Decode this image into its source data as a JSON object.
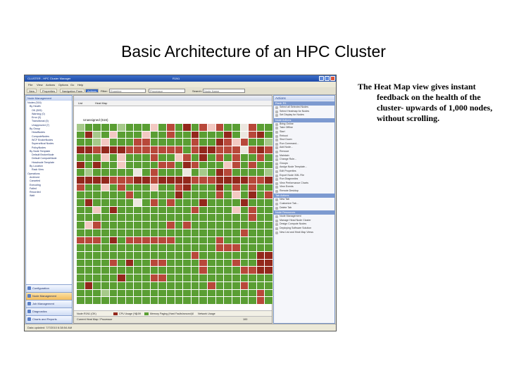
{
  "slide": {
    "title": "Basic Architecture of an HPC Cluster",
    "caption": "The Heat Map view gives instant feedback on the health of the cluster- upwards of 1,000 nodes, without scrolling."
  },
  "window": {
    "title": "CLUSTER - HPC Cluster Manager",
    "node_title": "R1N1"
  },
  "menu": [
    "File",
    "View",
    "Actions",
    "Options",
    "Go",
    "Help"
  ],
  "toolbar": {
    "buttons": [
      "New",
      "Properties",
      "Navigation Pane",
      "Actions"
    ],
    "filter_label": "Filter:",
    "filter_value": "Examine",
    "filter_value2": "Processor",
    "search_label": "Search:",
    "search_placeholder": "Node Name"
  },
  "left_pane": {
    "header": "Node Management",
    "tree": [
      "Nodes (516)",
      "By Health",
      "OK (509)",
      "Warning (0)",
      "Error (0)",
      "Transitional (0)",
      "Unapproved (7)",
      "By Group",
      "HeadNodes",
      "ComputeNodes",
      "WCF BrokerNodes",
      "Supercritical Nodes",
      "PolicyNodes",
      "By Node Template",
      "Default BrokerNode",
      "Default ComputeNode",
      "Headnode Template",
      "By Location",
      "Rack View",
      "Operations",
      "Archived",
      "Canceled",
      "Executing",
      "Failed",
      "Recorded",
      "Wait"
    ],
    "nav": [
      "Configuration",
      "Node Management",
      "Job Management",
      "Diagnostics",
      "Charts and Reports"
    ]
  },
  "center": {
    "tabs": [
      "List",
      "Heat Map"
    ],
    "group_label": "Unassigned (516)",
    "status": {
      "node_label": "Node:",
      "node_value": "R1N1 (OK)",
      "cpu_label": "CPU Usage (%):",
      "cpu_value": "2.59",
      "mem_label": "Memory Paging (Hard Faults/second):",
      "mem_value": "0",
      "network_label": "Network Usage",
      "current_view": "Current Heat Map / Processor",
      "zoom": "100"
    }
  },
  "heatmap": {
    "colors": {
      "g": "#5a9e33",
      "l": "#a6c98a",
      "p": "#f3c9c2",
      "w": "#ece7e0",
      "r": "#b8483a",
      "d": "#93281c"
    },
    "rows": [
      "lgggglgggpgrgdgrprggwrgg",
      "gdlgpgggpggrggdgggdgwrdg",
      "gglpgggrrgggggrggdrprggl",
      "ddrdddrrrrrrrgrddrrrwrdr",
      "gggpgpgggrggprgdgrgrggrg",
      "dgdggpggggrrgdrgggprgrgg",
      "glgggggwgrgggwglgdrggggl",
      "ddddrrrddrddddrrrddddrrd",
      "rggpgrgggpggrdgggdgrgrgg",
      "ggggggrgggggdggggrgpgdgr",
      "gdgggggwgrgrgggdggggdggg",
      "ggpgdgggggggggrggggpgrgg",
      "gggggggggggggggggggggrgg",
      "gprggggggggrgrgggggggggg",
      "ggggggggggggggggggggrggg",
      "rrrgdgrrrrrrgggggrgggggg",
      "gggggggggggggggggrrrgggg",
      "ggggggggggggggrgggggggdd",
      "ggggrgdggrrggggrgggrggdd",
      "gggggggggggggggrggggrrdd",
      "gggggdgggrrggggggggggggg",
      "gdggggggggggggggrgggrggg",
      "ggglggggggggggggggggggrg",
      "ggggggggggggggggggggggrg"
    ]
  },
  "actions": {
    "header": "Actions",
    "sections": [
      {
        "title": "Rack: R1",
        "items": [
          "Select all Selected Nodes",
          "Select Heatmap for Nodes",
          "Set Display for Nodes"
        ]
      },
      {
        "title": "Node Actions",
        "items": [
          "Bring Online",
          "Take Offline",
          "Start",
          "Reboot",
          "Shut Down",
          "Run Command...",
          "Add Node...",
          "Remove",
          "Maintain",
          "Change Role...",
          "Groups",
          "Assign Node Template...",
          "Edit Properties",
          "Export Node XML File",
          "Run Diagnostics",
          "View Performance Charts",
          "View Events",
          "Remote Desktop"
        ]
      },
      {
        "title": "Tab Actions",
        "items": [
          "New Tab",
          "Customize Tab...",
          "Delete Tab"
        ]
      },
      {
        "title": "Node Resources",
        "items": [
          "Node Management",
          "Manage Head Node Cluster",
          "Design Compute Nodes",
          "Deploying Software Solution",
          "New List and Heat Map Views"
        ]
      }
    ]
  },
  "statusbar": {
    "text": "Data updated: 7/7/2010 6:38:54 AM"
  }
}
